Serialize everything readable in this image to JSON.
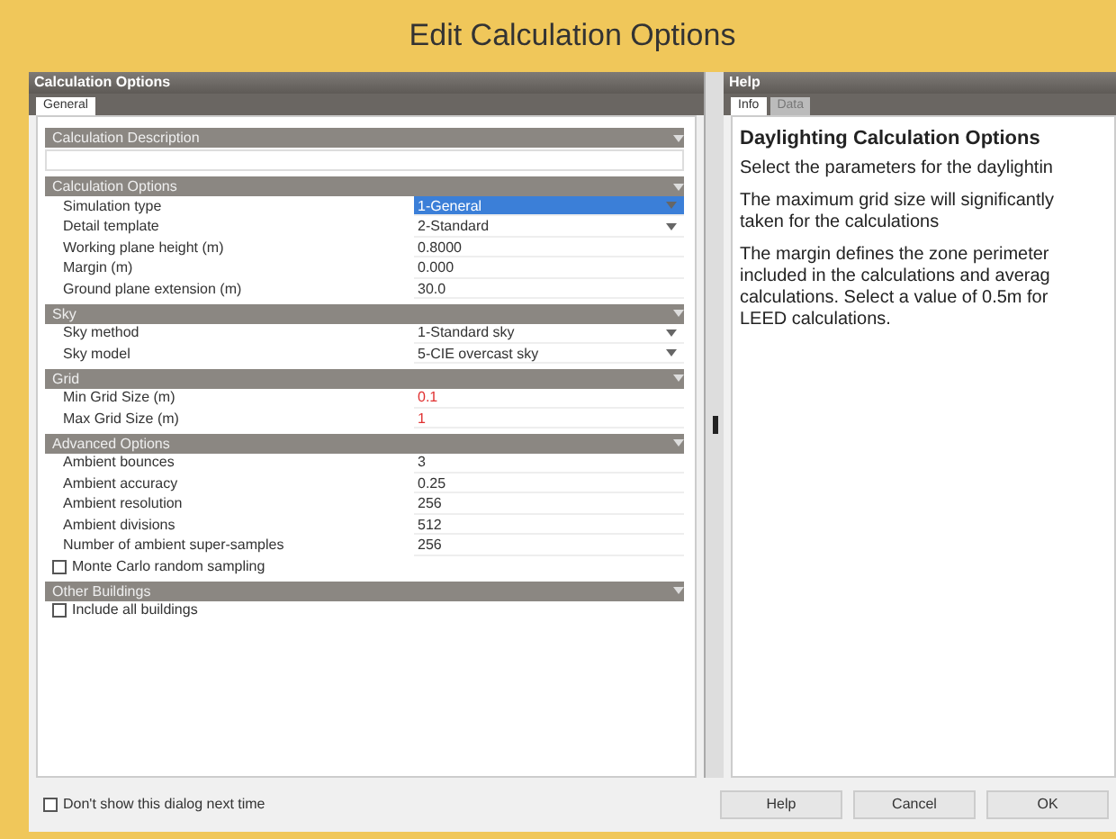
{
  "window": {
    "title": "Edit Calculation Options"
  },
  "left_panel": {
    "title": "Calculation Options",
    "tabs": [
      {
        "label": "General",
        "selected": true
      }
    ],
    "sections": [
      {
        "title": "Calculation Description",
        "rows": [
          {
            "kind": "blank"
          }
        ]
      },
      {
        "title": "Calculation Options",
        "rows": [
          {
            "kind": "dropdown",
            "label": "Simulation type",
            "value": "1-General",
            "selected": true
          },
          {
            "kind": "dropdown",
            "label": "Detail template",
            "value": "2-Standard",
            "selected": false
          },
          {
            "kind": "value",
            "label": "Working plane height (m)",
            "value": "0.8000",
            "invalid": false
          },
          {
            "kind": "value",
            "label": "Margin (m)",
            "value": "0.000",
            "invalid": false
          },
          {
            "kind": "value",
            "label": "Ground plane extension (m)",
            "value": "30.0",
            "invalid": false
          }
        ]
      },
      {
        "title": "Sky",
        "rows": [
          {
            "kind": "dropdown",
            "label": "Sky method",
            "value": "1-Standard sky",
            "selected": false
          },
          {
            "kind": "dropdown",
            "label": "Sky model",
            "value": "5-CIE overcast sky",
            "selected": false
          }
        ]
      },
      {
        "title": "Grid",
        "rows": [
          {
            "kind": "value",
            "label": "Min Grid Size (m)",
            "value": "0.1",
            "invalid": true
          },
          {
            "kind": "value",
            "label": "Max Grid Size (m)",
            "value": "1",
            "invalid": true
          }
        ]
      },
      {
        "title": "Advanced Options",
        "rows": [
          {
            "kind": "value",
            "label": "Ambient bounces",
            "value": "3",
            "invalid": false
          },
          {
            "kind": "value",
            "label": "Ambient accuracy",
            "value": "0.25",
            "invalid": false
          },
          {
            "kind": "value",
            "label": "Ambient resolution",
            "value": "256",
            "invalid": false
          },
          {
            "kind": "value",
            "label": "Ambient divisions",
            "value": "512",
            "invalid": false
          },
          {
            "kind": "value",
            "label": "Number of ambient super-samples",
            "value": "256",
            "invalid": false
          },
          {
            "kind": "checkbox",
            "label": "Monte Carlo random sampling",
            "checked": false
          }
        ]
      },
      {
        "title": "Other Buildings",
        "rows": [
          {
            "kind": "checkbox",
            "label": "Include all buildings",
            "checked": false
          }
        ]
      }
    ]
  },
  "help_panel": {
    "title": "Help",
    "tabs": [
      {
        "label": "Info",
        "selected": true
      },
      {
        "label": "Data",
        "selected": false
      }
    ],
    "heading": "Daylighting Calculation Options",
    "paragraphs": [
      [
        "Select the parameters for the daylightin"
      ],
      [
        "The maximum grid size will significantly",
        "taken for the calculations"
      ],
      [
        "The margin defines the zone perimeter",
        "included in the calculations and averag",
        "calculations. Select a value of 0.5m for",
        "LEED calculations."
      ]
    ]
  },
  "footer": {
    "checkbox": {
      "label": "Don't show this dialog next time",
      "checked": false
    },
    "buttons": [
      "Help",
      "Cancel",
      "OK"
    ]
  }
}
